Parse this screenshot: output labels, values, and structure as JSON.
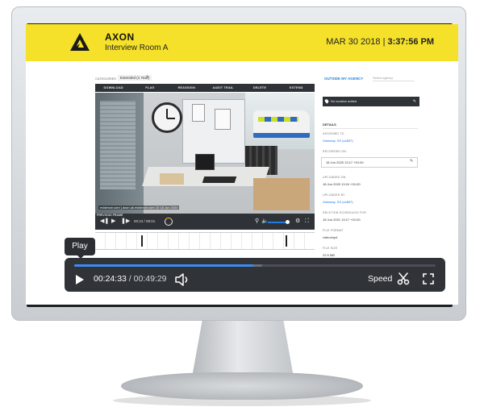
{
  "header": {
    "brand": "AXON",
    "subtitle": "Interview Room A",
    "date": "MAR 30 2018",
    "separator": "|",
    "time": "3:37:56",
    "ampm": "PM",
    "brand_color": "#f5e12a"
  },
  "category": {
    "label": "CATEGORIES",
    "value": "Extended (1 Year)"
  },
  "tabs": [
    "DOWNLOAD",
    "FLAG",
    "REASSIGN",
    "AUDIT TRAIL",
    "DELETE",
    "EXTEND"
  ],
  "video": {
    "overlay_text": "evidence.com | axon.uk evidence.com 10 18 Jun 2020"
  },
  "inner_player": {
    "previous_frame": "PREVIOUS FRAME",
    "time": "00:24  /  08:01"
  },
  "right_panel": {
    "outside_agency": "OUTSIDE MY AGENCY",
    "select_placeholder": "Select agency",
    "location": "No location added",
    "details_heading": "DETAILS",
    "assigned_to_label": "ASSIGNED TO",
    "assigned_to_value": "Gateway, SS (s4857)",
    "recorded_on_label": "RECORDED ON",
    "recorded_on_value": "18 Jun 2020 13:17 +01:00",
    "uploaded_on_label": "UPLOADED ON",
    "uploaded_on_value": "18 Jun 2020 13:24 +01:00",
    "uploaded_by_label": "UPLOADED BY",
    "uploaded_by_value": "Gateway, SS (s4857)",
    "deletion_label": "DELETION SCHEDULED FOR",
    "deletion_value": "18 Jun 2021 13:17 +01:00",
    "file_format_label": "FILE FORMAT",
    "file_format_value": "video/mp4",
    "file_size_label": "FILE SIZE",
    "file_size_value": "22.5 MB"
  },
  "player": {
    "tooltip": "Play",
    "current_time": "00:24:33",
    "separator": " / ",
    "duration": "00:49:29",
    "speed_label": "Speed",
    "progress_fraction": 0.496,
    "buffer_fraction": 0.52,
    "accent_color": "#3b8bf0"
  }
}
